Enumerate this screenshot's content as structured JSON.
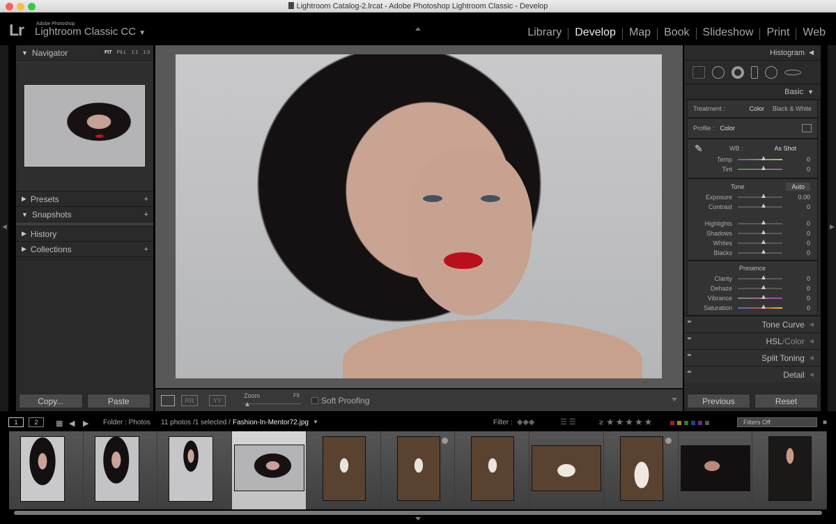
{
  "window": {
    "title": "Lightroom Catalog-2.lrcat - Adobe Photoshop Lightroom Classic - Develop"
  },
  "brand": {
    "logo": "Lr",
    "company": "Adobe Photoshop",
    "product": "Lightroom Classic CC",
    "menu_glyph": "▼"
  },
  "modules": {
    "library": "Library",
    "develop": "Develop",
    "map": "Map",
    "book": "Book",
    "slideshow": "Slideshow",
    "print": "Print",
    "web": "Web",
    "active": "Develop"
  },
  "left_panel": {
    "navigator": {
      "title": "Navigator",
      "opt_fit": "FIT",
      "opt_fill": "FILL",
      "opt_1_1": "1:1",
      "opt_1_3": "1:3"
    },
    "presets": "Presets",
    "snapshots": "Snapshots",
    "history": "History",
    "collections": "Collections",
    "plus": "+",
    "copy_button": "Copy...",
    "paste_button": "Paste"
  },
  "toolbar": {
    "zoom_label": "Zoom",
    "zoom_fit": "Fit",
    "soft_proofing": "Soft Proofing",
    "before_after_1": "RR",
    "before_after_2": "YY"
  },
  "right_panel": {
    "histogram": "Histogram",
    "basic": "Basic",
    "treatment_label": "Treatment :",
    "treatment_color": "Color",
    "treatment_bw": "Black & White",
    "profile_label": "Profile :",
    "profile_value": "Color",
    "wb_label": "WB :",
    "wb_value": "As Shot",
    "temp": {
      "label": "Temp",
      "value": "0"
    },
    "tint": {
      "label": "Tint",
      "value": "0"
    },
    "tone_label": "Tone",
    "auto_label": "Auto",
    "exposure": {
      "label": "Exposure",
      "value": "0.00"
    },
    "contrast": {
      "label": "Contrast",
      "value": "0"
    },
    "highlights": {
      "label": "Highlights",
      "value": "0"
    },
    "shadows": {
      "label": "Shadows",
      "value": "0"
    },
    "whites": {
      "label": "Whites",
      "value": "0"
    },
    "blacks": {
      "label": "Blacks",
      "value": "0"
    },
    "presence_label": "Presence",
    "clarity": {
      "label": "Clarity",
      "value": "0"
    },
    "dehaze": {
      "label": "Dehaze",
      "value": "0"
    },
    "vibrance": {
      "label": "Vibrance",
      "value": "0"
    },
    "saturation": {
      "label": "Saturation",
      "value": "0"
    },
    "tone_curve": "Tone Curve",
    "hsl": "HSL",
    "hsl_sep": " / ",
    "hsl_color": "Color",
    "split_toning": "Split Toning",
    "detail": "Detail",
    "previous_button": "Previous",
    "reset_button": "Reset"
  },
  "filmstrip": {
    "view1": "1",
    "view2": "2",
    "folder": "Folder : Photos",
    "count": "11 photos /1 selected /",
    "filename": "Fashion-In-Mentor72.jpg",
    "filter_label": "Filter :",
    "ge": "≥",
    "stars": "★★★★★",
    "filters_off": "Filters Off"
  },
  "colors": {
    "accent_red": "#fc605c",
    "accent_yellow": "#fdbc40",
    "accent_green": "#34c84a",
    "lips": "#b9101c"
  }
}
